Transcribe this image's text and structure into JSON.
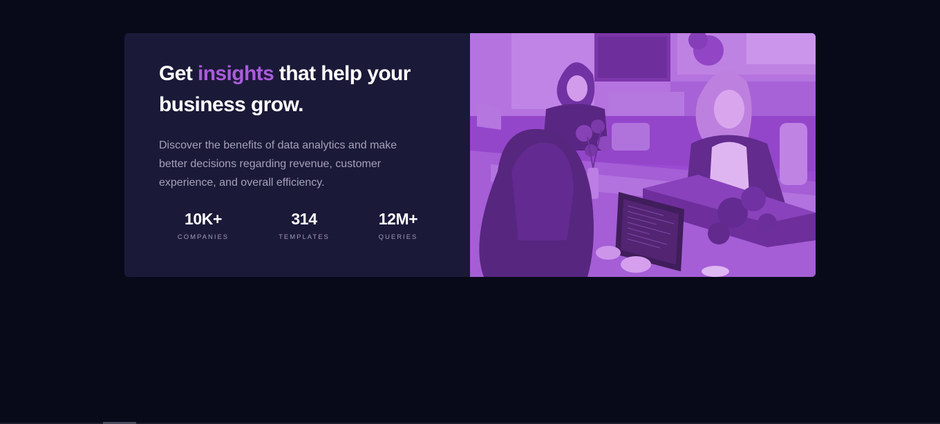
{
  "hero": {
    "headline_start": "Get ",
    "headline_accent": "insights",
    "headline_end": " that help your business grow.",
    "description": "Discover the benefits of data analytics and make better decisions regarding revenue, customer experience, and overall efficiency."
  },
  "stats": [
    {
      "value": "10K+",
      "label": "COMPANIES"
    },
    {
      "value": "314",
      "label": "TEMPLATES"
    },
    {
      "value": "12M+",
      "label": "QUERIES"
    }
  ],
  "image": {
    "icon": "team-photo",
    "tint_color": "#aa5cdb"
  },
  "colors": {
    "background": "#080a1a",
    "card": "#1b1938",
    "accent": "#aa5cdb",
    "text": "#ffffff",
    "muted": "#a3a2b8"
  }
}
